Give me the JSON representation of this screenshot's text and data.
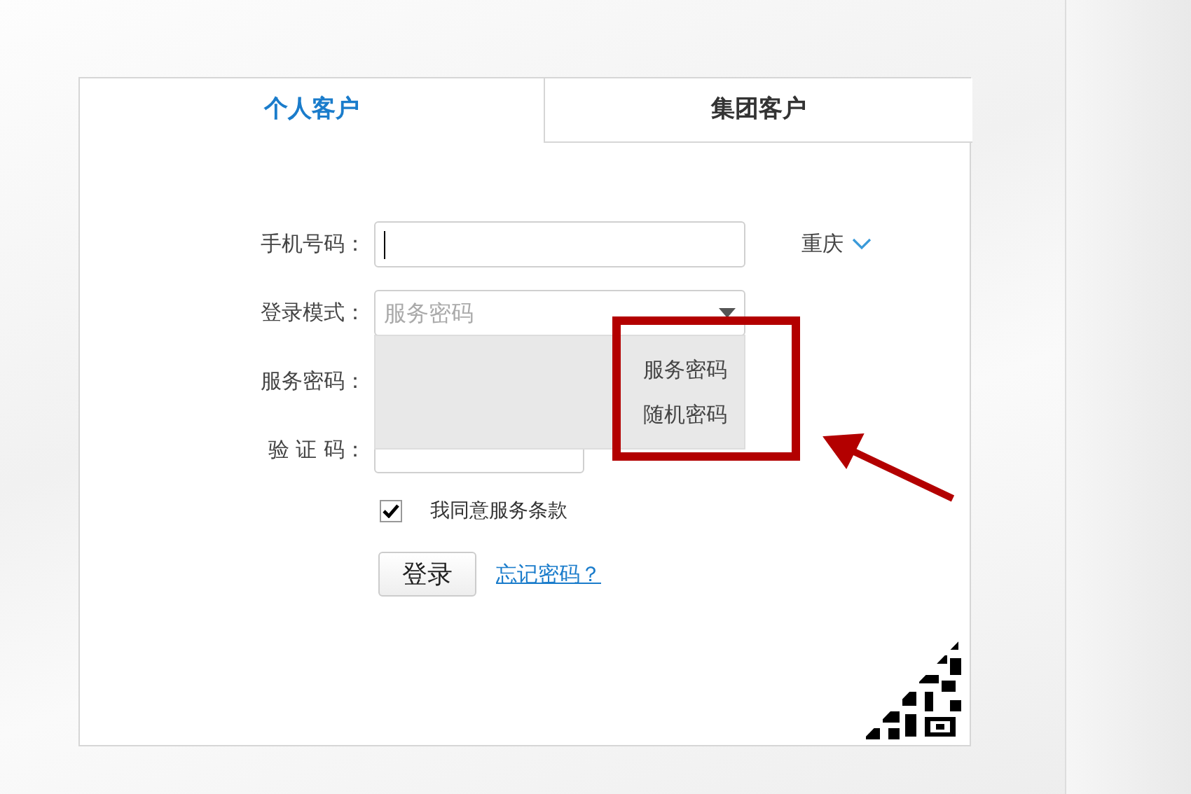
{
  "tabs": [
    {
      "label": "个人客户",
      "selected": true
    },
    {
      "label": "集团客户",
      "selected": false
    }
  ],
  "form": {
    "phone": {
      "label": "手机号码：",
      "focused": true
    },
    "city": {
      "label": "重庆"
    },
    "login_mode": {
      "label": "登录模式：",
      "value": "服务密码",
      "expanded": true,
      "options": [
        "服务密码",
        "随机密码"
      ]
    },
    "service_password": {
      "label": "服务密码："
    },
    "captcha": {
      "label": "验 证 码："
    },
    "agree": {
      "label": "我同意服务条款",
      "checked": true
    },
    "login_button": "登录",
    "forgot_link": "忘记密码？"
  }
}
